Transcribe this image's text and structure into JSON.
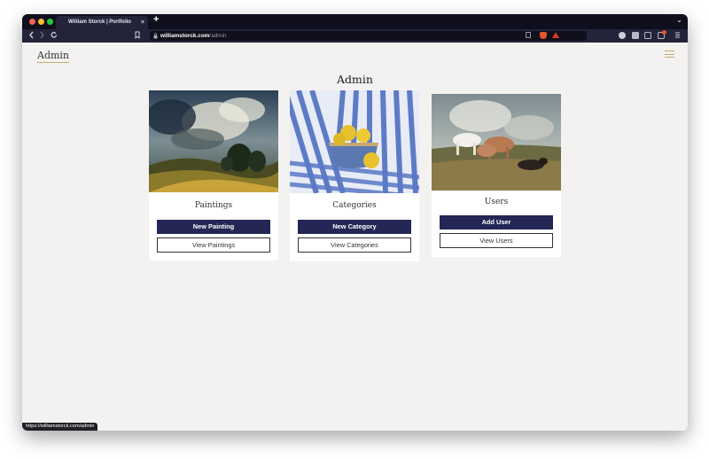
{
  "browser": {
    "tab_title": "William Storck | Portfolio",
    "tab_close": "×",
    "new_tab": "+",
    "tab_menu": "⌄",
    "url_host": "williamstorck.com",
    "url_path": "/admin",
    "status_url": "https://williamstorck.com/admin"
  },
  "site": {
    "logo": "Admin",
    "page_title": "Admin"
  },
  "cards": [
    {
      "title": "Paintings",
      "primary_label": "New Painting",
      "secondary_label": "View Paintings"
    },
    {
      "title": "Categories",
      "primary_label": "New Category",
      "secondary_label": "View Categories"
    },
    {
      "title": "Users",
      "primary_label": "Add User",
      "secondary_label": "View Users"
    }
  ],
  "colors": {
    "accent": "#c9a86a",
    "primary_button": "#242656",
    "page_background": "#f3f2f1"
  },
  "icons": [
    "back-icon",
    "forward-icon",
    "reload-icon",
    "bookmark-icon",
    "lock-icon",
    "share-icon",
    "brave-shield-icon",
    "rewards-icon",
    "extension-icon",
    "puzzle-icon",
    "sidebar-icon",
    "wallet-icon",
    "menu-icon",
    "hamburger-icon"
  ]
}
